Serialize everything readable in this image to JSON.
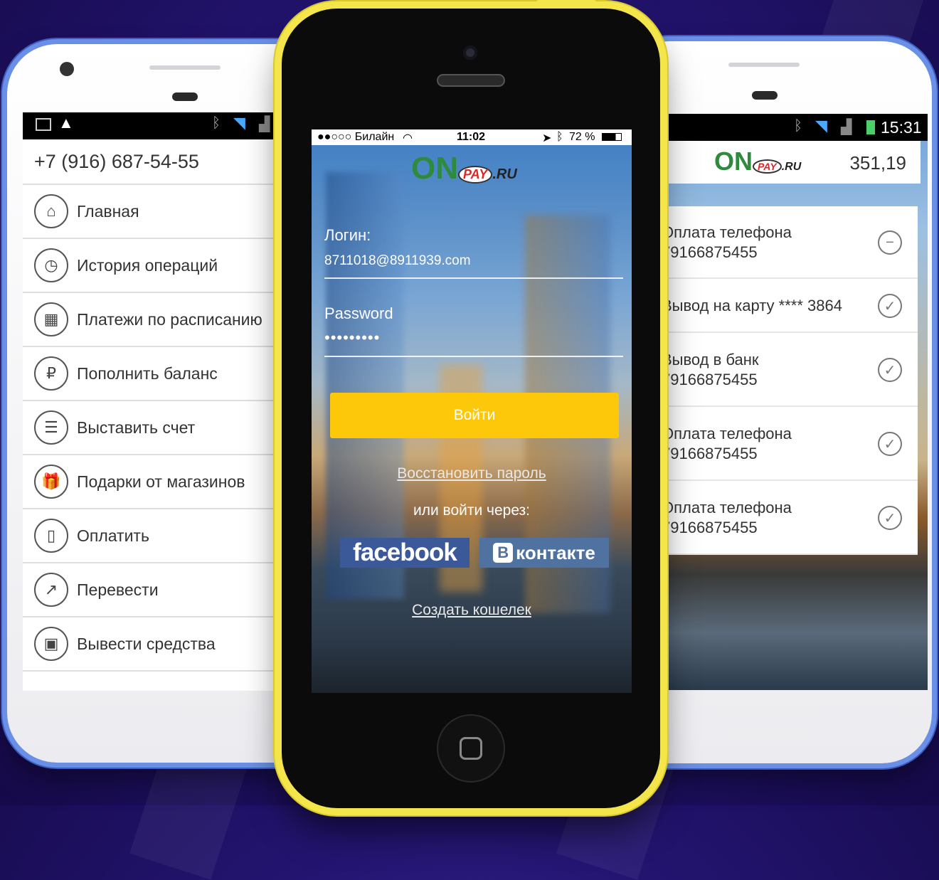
{
  "left_screen": {
    "phone_number": "+7 (916) 687-54-55",
    "menu": [
      {
        "label": "Главная",
        "icon": "home-icon",
        "glyph": "⌂",
        "has_chevron": false
      },
      {
        "label": "История операций",
        "icon": "clock-icon",
        "glyph": "◷",
        "has_chevron": false
      },
      {
        "label": "Платежи по расписанию",
        "icon": "calendar-icon",
        "glyph": "▦",
        "has_chevron": false
      },
      {
        "label": "Пополнить баланс",
        "icon": "ruble-coin-icon",
        "glyph": "₽",
        "has_chevron": true
      },
      {
        "label": "Выставить счет",
        "icon": "invoice-icon",
        "glyph": "☰",
        "has_chevron": true
      },
      {
        "label": "Подарки от магазинов",
        "icon": "gift-icon",
        "glyph": "🎁",
        "has_chevron": false
      },
      {
        "label": "Оплатить",
        "icon": "phone-icon",
        "glyph": "▯",
        "has_chevron": true
      },
      {
        "label": "Перевести",
        "icon": "arrow-up-right-icon",
        "glyph": "↗",
        "has_chevron": true
      },
      {
        "label": "Вывести средства",
        "icon": "wallet-icon",
        "glyph": "▣",
        "has_chevron": true
      }
    ]
  },
  "center_screen": {
    "status": {
      "carrier": "●●○○○ Билайн",
      "time": "11:02",
      "battery": "72 %"
    },
    "logo": {
      "on": "ON",
      "pay": "PAY",
      "ru": ".RU"
    },
    "login_label": "Логин:",
    "login_value": "8711018@8911939.com",
    "password_label": "Password",
    "password_value": "•••••••••",
    "login_button": "Войти",
    "restore_link": "Восстановить пароль",
    "or_text": "или войти через:",
    "facebook_label": "facebook",
    "vk_label": "контакте",
    "vk_badge": "В",
    "create_wallet_link": "Создать кошелек"
  },
  "right_screen": {
    "status_time": "15:31",
    "balance": "351,19",
    "transactions": [
      {
        "line1": "Оплата телефона",
        "line2": "79166875455",
        "status": "minus-circle-icon",
        "glyph": "−"
      },
      {
        "line1": "Вывод на карту **** 3864",
        "line2": "",
        "status": "check-circle-icon",
        "glyph": "✓"
      },
      {
        "line1": "Вывод в банк",
        "line2": "79166875455",
        "status": "check-circle-icon",
        "glyph": "✓"
      },
      {
        "line1": "Оплата телефона",
        "line2": "79166875455",
        "status": "check-circle-icon",
        "glyph": "✓"
      },
      {
        "line1": "Оплата телефона",
        "line2": "79166875455",
        "status": "check-circle-icon",
        "glyph": "✓"
      }
    ]
  },
  "colors": {
    "background": "#231470",
    "android_frame": "#6a8fe6",
    "iphone_frame": "#f4e64a",
    "button_yellow": "#fdc80a",
    "facebook": "#3b5998",
    "vk": "#4f72a0",
    "logo_green": "#2e8b3e",
    "logo_red": "#d42a2a"
  }
}
